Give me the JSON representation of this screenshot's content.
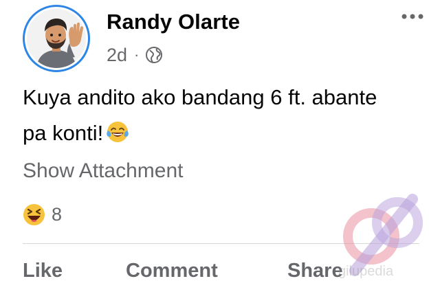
{
  "post": {
    "author": {
      "name": "Randy Olarte",
      "avatar": "memoji-avatar-waving"
    },
    "time": "2d",
    "separator": "·",
    "audience_icon": "globe-icon",
    "more_icon": "more-horizontal-icon",
    "text_line1": "Kuya andito ako bandang 6 ft. abante",
    "text_line2": "pa konti!",
    "text_emoji": "tears-of-joy-emoji",
    "show_attachment_label": "Show Attachment",
    "reactions": {
      "icon": "laughing-squint-reaction-icon",
      "count": "8"
    },
    "actions": {
      "like_label": "Like",
      "comment_label": "Comment",
      "share_label": "Share"
    }
  },
  "watermark": {
    "text": "gilupedia",
    "colors": [
      "#e98fa0",
      "#b7a0dc"
    ]
  },
  "colors": {
    "avatar_ring": "#2d86e6",
    "primary_text": "#050505",
    "secondary_text": "#65676b",
    "divider": "#d4d6da",
    "reaction_yellow": "#f7c23c"
  }
}
